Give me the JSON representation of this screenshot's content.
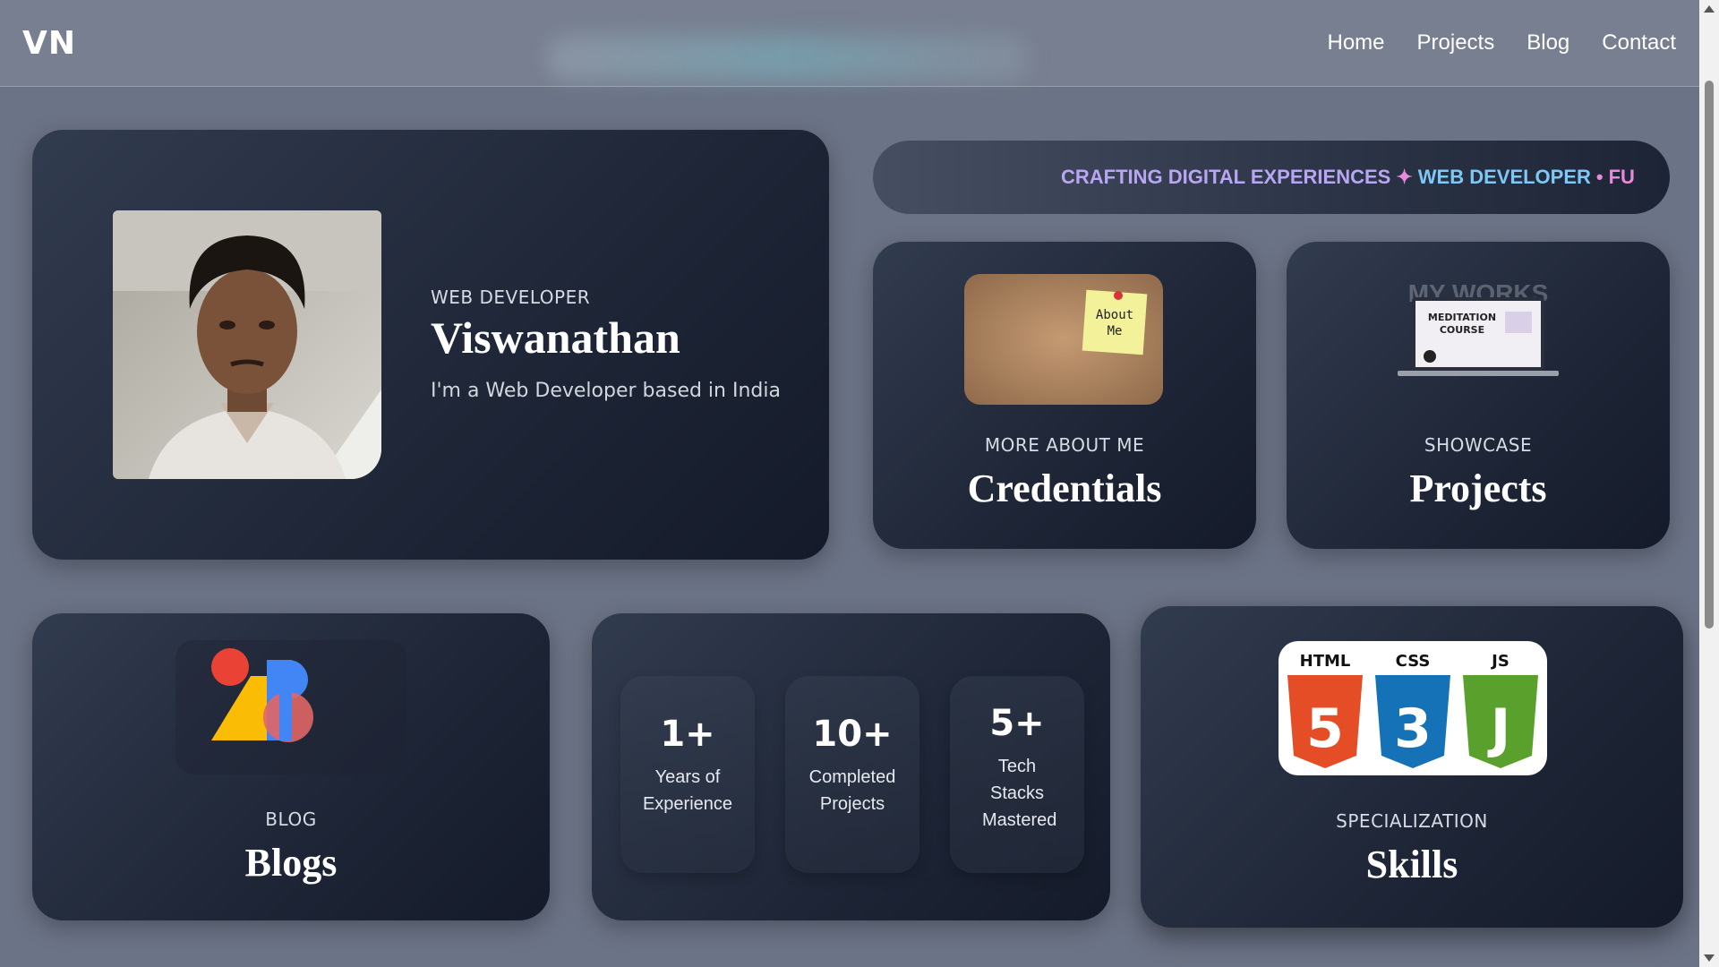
{
  "nav": {
    "logo": "VN",
    "links": [
      "Home",
      "Projects",
      "Blog",
      "Contact"
    ]
  },
  "hero": {
    "role": "WEB DEVELOPER",
    "name": "Viswanathan",
    "tagline": "I'm a Web Developer based in India"
  },
  "marquee": {
    "part1": "CRAFTING DIGITAL EXPERIENCES",
    "star": "✦",
    "part2": "WEB DEVELOPER",
    "dot": "•",
    "part3": "FU"
  },
  "credentials": {
    "eyebrow": "MORE ABOUT ME",
    "title": "Credentials",
    "note_text": "About Me"
  },
  "projects": {
    "eyebrow": "SHOWCASE",
    "title": "Projects",
    "thumb_heading": "MY WORKS",
    "thumb_screen": "MEDITATION COURSE"
  },
  "blogs": {
    "eyebrow": "BLOG",
    "title": "Blogs"
  },
  "stats": [
    {
      "value": "1+",
      "label": "Years of Experience"
    },
    {
      "value": "10+",
      "label": "Completed Projects"
    },
    {
      "value": "5+",
      "label": "Tech Stacks Mastered"
    }
  ],
  "skills": {
    "eyebrow": "SPECIALIZATION",
    "title": "Skills",
    "badges": [
      "HTML",
      "CSS",
      "JS"
    ],
    "badge_digits": [
      "5",
      "3",
      "J"
    ]
  },
  "colors": {
    "background": "#6b7386",
    "card_dark": "#1f2738",
    "html_orange": "#e44d26",
    "css_blue": "#1572b6",
    "js_green": "#5aa02c"
  }
}
